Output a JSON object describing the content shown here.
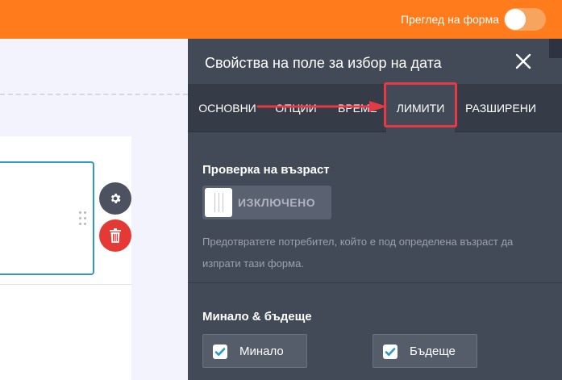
{
  "topbar": {
    "preview_label": "Преглед на форма",
    "bg_color": "#ff7b1c"
  },
  "panel": {
    "title": "Свойства на поле за избор на дата",
    "tabs": [
      {
        "label": "ОСНОВНИ"
      },
      {
        "label": "ОПЦИИ"
      },
      {
        "label": "ВРЕМЕ"
      },
      {
        "label": "ЛИМИТИ",
        "active": true
      },
      {
        "label": "РАЗШИРЕНИ"
      }
    ],
    "age_check": {
      "title": "Проверка на възраст",
      "toggle_state": "ИЗКЛЮЧЕНО",
      "help": "Предотвратете потребител, който е под определена възраст да изпрати тази форма."
    },
    "past_future": {
      "title": "Минало & бъдеще",
      "options": [
        {
          "label": "Минало",
          "checked": true
        },
        {
          "label": "Бъдеще",
          "checked": true
        }
      ]
    }
  },
  "colors": {
    "highlight": "#e53945",
    "accent_blue": "#2e98c6",
    "delete_red": "#e53935",
    "panel_bg": "#434a57"
  }
}
